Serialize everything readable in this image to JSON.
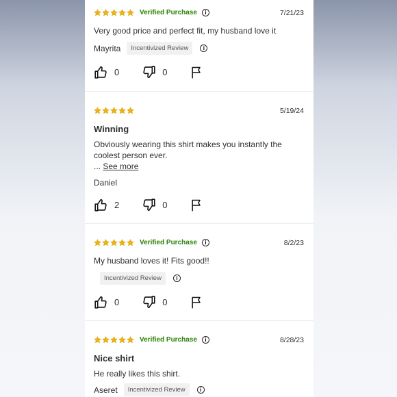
{
  "verified_label": "Verified Purchase",
  "incentivized_label": "Incentivized Review",
  "see_more_prefix": "...",
  "see_more_label": "See more",
  "star_color": "#f6b200",
  "reviews": [
    {
      "date": "7/21/23",
      "verified": true,
      "title": "",
      "text": "Very good price and perfect fit, my husband love it",
      "author": "Mayrita",
      "incentivized": true,
      "helpful": "0",
      "unhelpful": "0"
    },
    {
      "date": "5/19/24",
      "verified": false,
      "title": "Winning",
      "text": "Obviously wearing this shirt makes you instantly the coolest person ever.",
      "author": "Daniel",
      "incentivized": false,
      "helpful": "2",
      "unhelpful": "0"
    },
    {
      "date": "8/2/23",
      "verified": true,
      "title": "",
      "text": "My husband loves it! Fits good!!",
      "author": "",
      "incentivized": true,
      "helpful": "0",
      "unhelpful": "0"
    },
    {
      "date": "8/28/23",
      "verified": true,
      "title": "Nice shirt",
      "text": "He really likes this shirt.",
      "author": "Aseret",
      "incentivized": true,
      "helpful": "",
      "unhelpful": ""
    }
  ]
}
